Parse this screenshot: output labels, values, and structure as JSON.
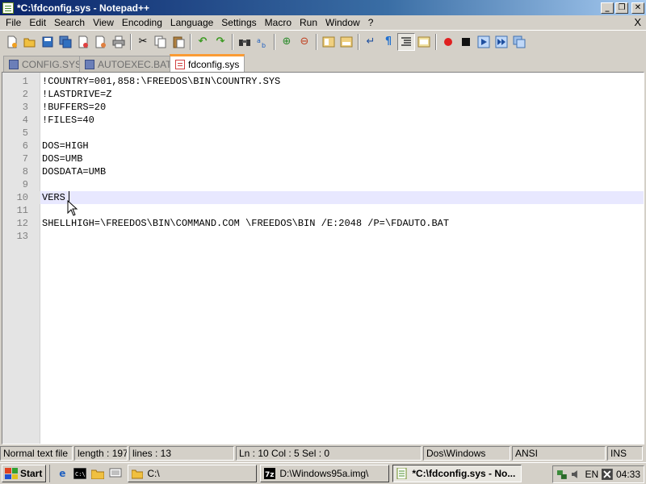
{
  "window": {
    "title": "*C:\\fdconfig.sys - Notepad++",
    "minimize": "_",
    "restore": "❐",
    "close": "✕"
  },
  "menu": [
    "File",
    "Edit",
    "Search",
    "View",
    "Encoding",
    "Language",
    "Settings",
    "Macro",
    "Run",
    "Window",
    "?"
  ],
  "menu_close": "X",
  "toolbar": [
    "new-file-icon",
    "open-file-icon",
    "save-icon",
    "save-all-icon",
    "close-icon",
    "close-all-icon",
    "print-icon",
    "cut-icon",
    "copy-icon",
    "paste-icon",
    "undo-icon",
    "redo-icon",
    "find-icon",
    "replace-icon",
    "zoom-in-icon",
    "zoom-out-icon",
    "sync-vertical-icon",
    "sync-horizontal-icon",
    "word-wrap-icon",
    "show-all-characters-icon",
    "indent-guide-icon",
    "user-defined-dialog-icon",
    "record-macro-icon",
    "stop-macro-icon",
    "play-macro-icon",
    "run-macro-multiple-icon",
    "save-macro-icon"
  ],
  "tabs": [
    {
      "label": "CONFIG.SYS",
      "active": false
    },
    {
      "label": "AUTOEXEC.BAT",
      "active": false
    },
    {
      "label": "fdconfig.sys",
      "active": true
    }
  ],
  "editor": {
    "current_line": 10,
    "lines": [
      {
        "n": "1",
        "text": "!COUNTRY=001,858:\\FREEDOS\\BIN\\COUNTRY.SYS"
      },
      {
        "n": "2",
        "text": "!LASTDRIVE=Z"
      },
      {
        "n": "3",
        "text": "!BUFFERS=20"
      },
      {
        "n": "4",
        "text": "!FILES=40"
      },
      {
        "n": "5",
        "text": ""
      },
      {
        "n": "6",
        "text": "DOS=HIGH"
      },
      {
        "n": "7",
        "text": "DOS=UMB"
      },
      {
        "n": "8",
        "text": "DOSDATA=UMB"
      },
      {
        "n": "9",
        "text": ""
      },
      {
        "n": "10",
        "text": "VERS"
      },
      {
        "n": "11",
        "text": ""
      },
      {
        "n": "12",
        "text": "SHELLHIGH=\\FREEDOS\\BIN\\COMMAND.COM \\FREEDOS\\BIN /E:2048 /P=\\FDAUTO.BAT"
      },
      {
        "n": "13",
        "text": ""
      }
    ]
  },
  "status": {
    "type": "Normal text file",
    "length": "length : 197",
    "lines": "lines : 13",
    "position": "Ln : 10    Col : 5    Sel : 0",
    "eol": "Dos\\Windows",
    "encoding": "ANSI",
    "mode": "INS"
  },
  "taskbar": {
    "start": "Start",
    "tasks": [
      {
        "label": "C:\\",
        "active": false
      },
      {
        "label": "D:\\Windows95a.img\\",
        "active": false
      },
      {
        "label": "*C:\\fdconfig.sys - No...",
        "active": true
      }
    ],
    "lang": "EN",
    "clock": "04:33"
  },
  "colors": {
    "active_tab_accent": "#fa9b34",
    "current_line": "#e8e8ff",
    "title_gradient_start": "#0a246a"
  }
}
